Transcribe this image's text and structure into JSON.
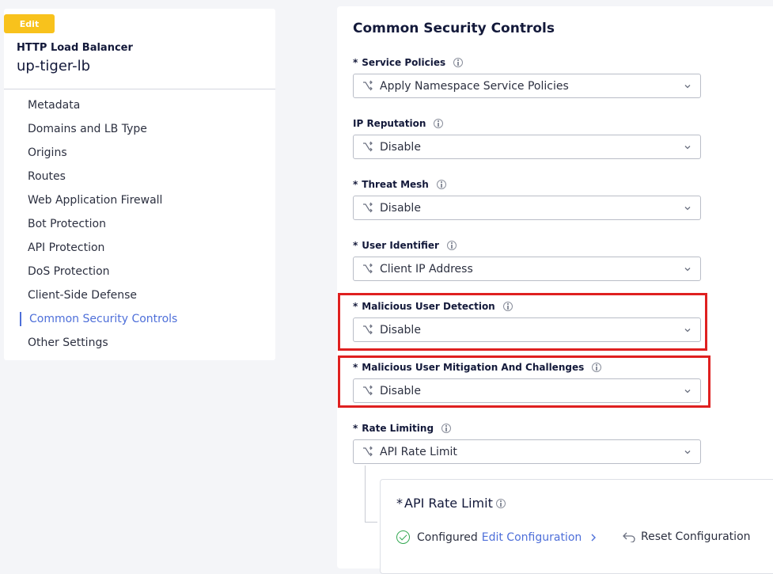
{
  "sidebar": {
    "edit_badge": "Edit",
    "lb_type": "HTTP Load Balancer",
    "lb_name": "up-tiger-lb",
    "items": [
      {
        "label": "Metadata"
      },
      {
        "label": "Domains and LB Type"
      },
      {
        "label": "Origins"
      },
      {
        "label": "Routes"
      },
      {
        "label": "Web Application Firewall"
      },
      {
        "label": "Bot Protection"
      },
      {
        "label": "API Protection"
      },
      {
        "label": "DoS Protection"
      },
      {
        "label": "Client-Side Defense"
      },
      {
        "label": "Common Security Controls",
        "active": true
      },
      {
        "label": "Other Settings"
      }
    ]
  },
  "main": {
    "title": "Common Security Controls",
    "fields": [
      {
        "label": "Service Policies",
        "required": true,
        "value": "Apply Namespace Service Policies"
      },
      {
        "label": "IP Reputation",
        "required": false,
        "value": "Disable"
      },
      {
        "label": "Threat Mesh",
        "required": true,
        "value": "Disable"
      },
      {
        "label": "User Identifier",
        "required": true,
        "value": "Client IP Address"
      },
      {
        "label": "Malicious User Detection",
        "required": true,
        "value": "Disable",
        "highlighted": true
      },
      {
        "label": "Malicious User Mitigation And Challenges",
        "required": true,
        "value": "Disable",
        "highlighted": true
      },
      {
        "label": "Rate Limiting",
        "required": true,
        "value": "API Rate Limit"
      }
    ],
    "required_mark": "*",
    "rate_limit_card": {
      "title": "API Rate Limit",
      "status": "Configured",
      "edit_link": "Edit Configuration",
      "reset_label": "Reset Configuration"
    }
  },
  "colors": {
    "accent": "#4e6fd9",
    "edit_badge": "#f8c21c",
    "highlight": "#df2020",
    "success": "#33a852"
  }
}
